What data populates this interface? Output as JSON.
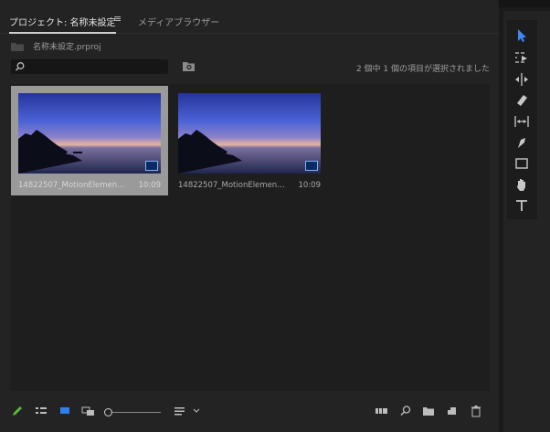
{
  "tabs": {
    "project_tab": "プロジェクト: 名称未設定",
    "tab_menu_glyph": "≡",
    "media_browser_tab": "メディアブラウザー"
  },
  "project": {
    "file_name": "名称未設定.prproj"
  },
  "search": {
    "placeholder": ""
  },
  "status": {
    "selection_text": "2 個中 1 個の項目が選択されました"
  },
  "clips": [
    {
      "name": "14822507_MotionElement...",
      "duration": "10:09",
      "selected": true
    },
    {
      "name": "14822507_MotionElement...",
      "duration": "10:09",
      "selected": false
    }
  ],
  "bottom_toolbar": {
    "icons": [
      "pencil-icon",
      "list-view-icon",
      "icon-view-icon",
      "freeform-view-icon",
      "zoom-slider",
      "sort-icon",
      "automate-to-sequence-icon",
      "find-icon",
      "new-bin-icon",
      "new-item-icon",
      "clear-icon"
    ]
  },
  "tools": [
    "selection-tool",
    "track-select-tool",
    "ripple-edit-tool",
    "razor-tool",
    "slip-tool",
    "pen-tool",
    "rectangle-tool",
    "hand-tool",
    "type-tool"
  ],
  "colors": {
    "panel_bg": "#232323",
    "selected_card": "#9a9a9a",
    "accent_blue": "#2f80ed"
  }
}
